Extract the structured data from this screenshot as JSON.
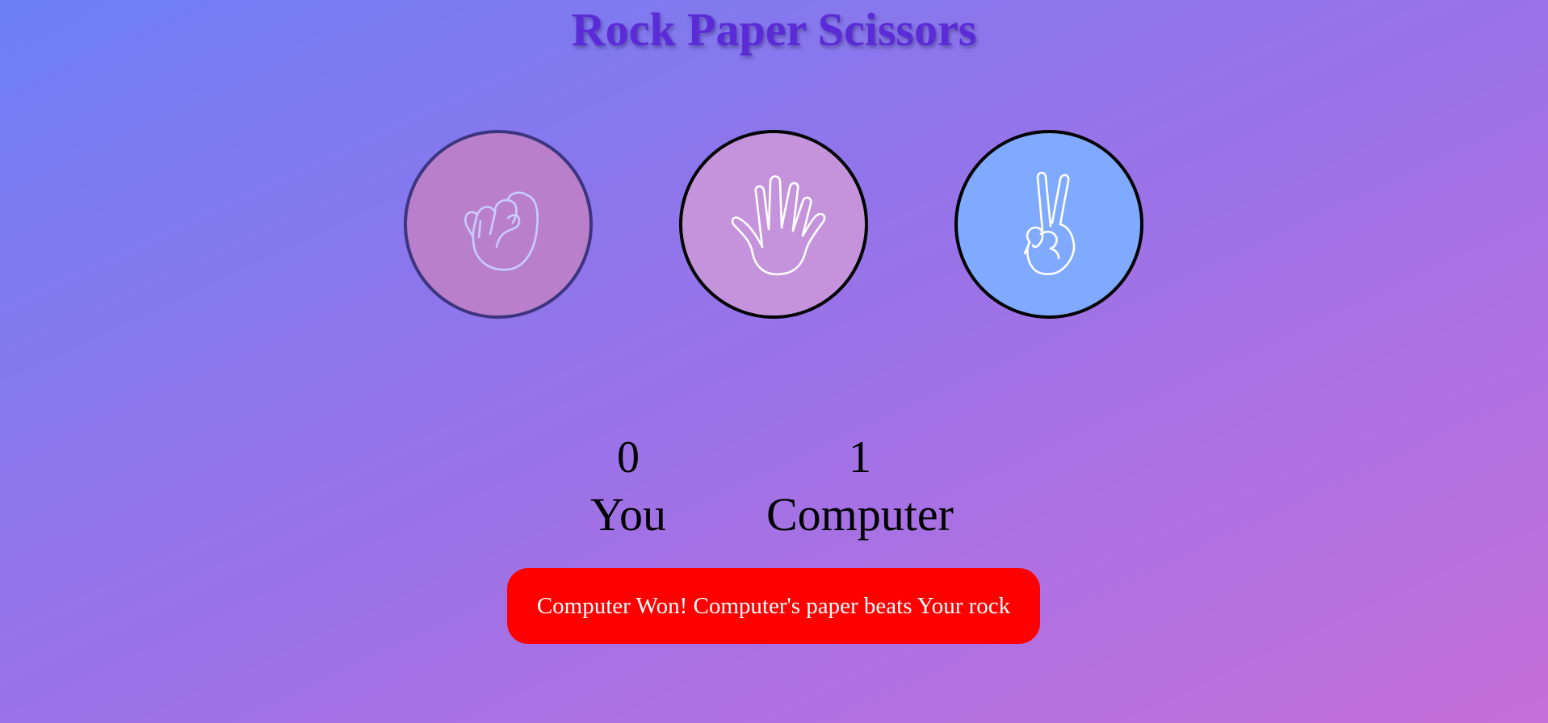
{
  "app": {
    "title": "Rock Paper Scissors"
  },
  "choices": [
    {
      "id": "rock",
      "icon": "rock-fist-icon",
      "bg_color": "#b97fca",
      "border_color": "#3e3580"
    },
    {
      "id": "paper",
      "icon": "paper-hand-icon",
      "bg_color": "#c593dc",
      "border_color": "#000000"
    },
    {
      "id": "scissors",
      "icon": "scissors-hand-icon",
      "bg_color": "#80aaff",
      "border_color": "#000000"
    }
  ],
  "scoreboard": {
    "user_score": "0",
    "user_label": "You",
    "computer_score": "1",
    "computer_label": "Computer"
  },
  "result": {
    "message": "Computer Won! Computer's paper beats Your rock",
    "status": "lose",
    "bg_color": "#ff0000"
  },
  "colors": {
    "title": "#5a2bd6",
    "background_start": "#6d7ff5",
    "background_mid": "#9b72e8",
    "background_end": "#c56fda",
    "icon_stroke_rock": "#c9ccff",
    "icon_stroke": "#ffffff"
  }
}
